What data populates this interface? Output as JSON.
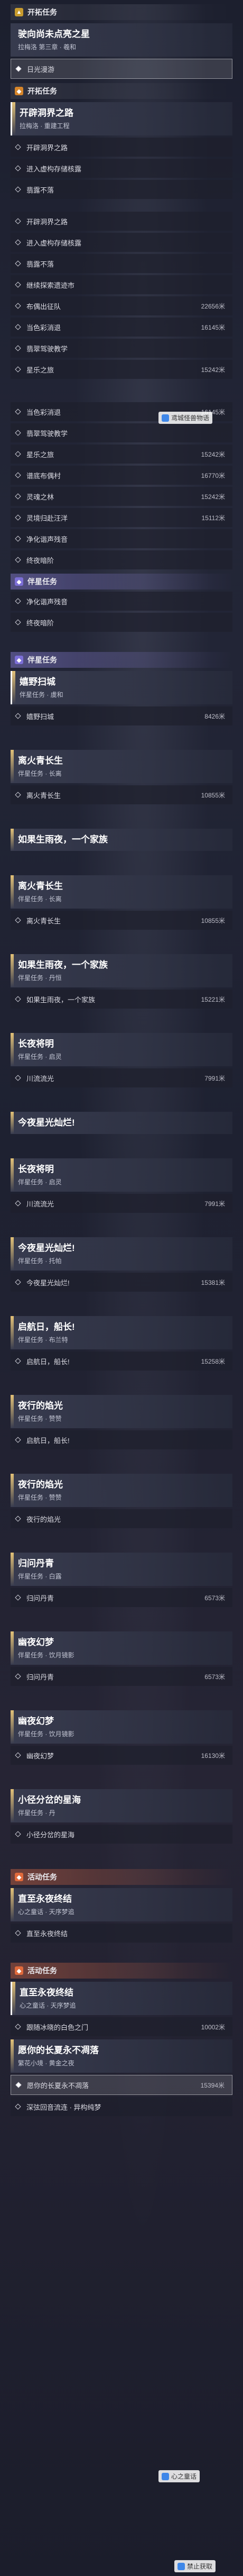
{
  "trailblaze": {
    "header": "开拓任务",
    "main_title": "驶向尚未点亮之星",
    "main_subtitle": "拉梅洛 第三章 · 羲和",
    "current_step": "日光漫游"
  },
  "quest_header": "开拓任务",
  "quest": {
    "title": "开辟洞界之路",
    "subtitle": "拉梅洛 · 重建工程"
  },
  "steps_group_a": [
    {
      "label": "开辟洞界之路",
      "dist": ""
    },
    {
      "label": "进入虚构存储核露",
      "dist": ""
    },
    {
      "label": "翡露不落",
      "dist": ""
    }
  ],
  "steps_group_b": [
    {
      "label": "开辟洞界之路",
      "dist": ""
    },
    {
      "label": "进入虚构存储核露",
      "dist": ""
    },
    {
      "label": "翡露不落",
      "dist": ""
    },
    {
      "label": "继续探索遗迹市",
      "dist": ""
    },
    {
      "label": "布偶出征队",
      "dist": "22656米"
    },
    {
      "label": "当色彩消退",
      "dist": "16145米"
    },
    {
      "label": "翡翠驾驶教学",
      "dist": ""
    },
    {
      "label": "星乐之旅",
      "dist": "15242米"
    }
  ],
  "steps_group_c": [
    {
      "label": "当色彩消退",
      "dist": "16145米"
    },
    {
      "label": "翡翠驾驶教学",
      "dist": ""
    },
    {
      "label": "星乐之旅",
      "dist": "15242米"
    },
    {
      "label": "谱底布偶村",
      "dist": "16770米"
    },
    {
      "label": "灵魂之林",
      "dist": "15242米"
    },
    {
      "label": "灵境归赴汪洋",
      "dist": "15112米"
    },
    {
      "label": "净化谐声残音",
      "dist": ""
    },
    {
      "label": "终夜暗阶",
      "dist": ""
    }
  ],
  "side_header": "伴星任务",
  "side_steps": [
    {
      "label": "净化谐声残音",
      "dist": ""
    },
    {
      "label": "终夜暗阶",
      "dist": ""
    }
  ],
  "side_header_2": "伴星任务",
  "side_quests": [
    {
      "title": "嬉野扫城",
      "subtitle": "伴星任务 · 虞和",
      "steps": [
        {
          "label": "嬉野扫城",
          "dist": "8426米"
        }
      ]
    },
    {
      "title": "离火青长生",
      "subtitle": "伴星任务 · 长离",
      "steps": [
        {
          "label": "离火青长生",
          "dist": "10855米"
        }
      ]
    },
    {
      "title": "如果生雨夜，一个家族",
      "subtitle": "",
      "steps": []
    },
    {
      "title": "离火青长生",
      "subtitle": "伴星任务 · 长离",
      "steps": [
        {
          "label": "离火青长生",
          "dist": "10855米"
        }
      ]
    },
    {
      "title": "如果生雨夜，一个家族",
      "subtitle": "伴星任务 · 丹恒",
      "steps": [
        {
          "label": "如果生雨夜，一个家族",
          "dist": "15221米"
        }
      ]
    },
    {
      "title": "长夜将明",
      "subtitle": "伴星任务 · 启灵",
      "steps": [
        {
          "label": "川流流光",
          "dist": "7991米"
        }
      ]
    },
    {
      "title": "今夜星光灿烂!",
      "subtitle": "",
      "steps": []
    },
    {
      "title": "长夜将明",
      "subtitle": "伴星任务 · 启灵",
      "steps": [
        {
          "label": "川流流光",
          "dist": "7991米"
        }
      ]
    },
    {
      "title": "今夜星光灿烂!",
      "subtitle": "伴星任务 · 托帕",
      "steps": [
        {
          "label": "今夜星光灿烂!",
          "dist": "15381米"
        }
      ]
    },
    {
      "title": "启航日，船长!",
      "subtitle": "伴星任务 · 布兰特",
      "steps": [
        {
          "label": "启航日，船长!",
          "dist": "15258米"
        }
      ]
    },
    {
      "title": "夜行的焰光",
      "subtitle": "伴星任务 · 赞赞",
      "steps": [
        {
          "label": "启航日，船长!",
          "dist": ""
        }
      ]
    },
    {
      "title": "夜行的焰光",
      "subtitle": "伴星任务 · 赞赞",
      "steps": [
        {
          "label": "夜行的焰光",
          "dist": ""
        }
      ]
    },
    {
      "title": "归问丹青",
      "subtitle": "伴星任务 · 白露",
      "steps": [
        {
          "label": "归问丹青",
          "dist": "6573米"
        }
      ]
    },
    {
      "title": "幽夜幻梦",
      "subtitle": "伴星任务 · 饮月镜影",
      "steps": [
        {
          "label": "归问丹青",
          "dist": "6573米"
        }
      ]
    },
    {
      "title": "幽夜幻梦",
      "subtitle": "伴星任务 · 饮月镜影",
      "steps": [
        {
          "label": "幽夜幻梦",
          "dist": "16130米"
        }
      ]
    },
    {
      "title": "小径分岔的星海",
      "subtitle": "伴星任务 · 丹",
      "steps": [
        {
          "label": "小径分岔的星海",
          "dist": ""
        }
      ]
    }
  ],
  "event_header": "活动任务",
  "event_quest": {
    "title": "直至永夜终结",
    "subtitle": "心之童话 · 天序梦追",
    "steps": [
      {
        "label": "直至永夜终结",
        "dist": ""
      }
    ]
  },
  "event_header_2": "活动任务",
  "event_quests_2": [
    {
      "title": "直至永夜终结",
      "subtitle": "心之童话 · 天序梦追",
      "steps": [
        {
          "label": "跟随冰晓的白色之门",
          "dist": "10002米"
        }
      ]
    },
    {
      "title": "愿你的长夏永不凋落",
      "subtitle": "繁花小境 · 黄金之夜",
      "steps": [
        {
          "label": "愿你的长夏永不凋落",
          "dist": "15394米"
        },
        {
          "label": "深弦回音流连 · 异构纯梦",
          "dist": ""
        }
      ]
    }
  ],
  "watermarks": [
    "鸢城怪兽物语",
    "心之童话",
    "禁止获取"
  ]
}
